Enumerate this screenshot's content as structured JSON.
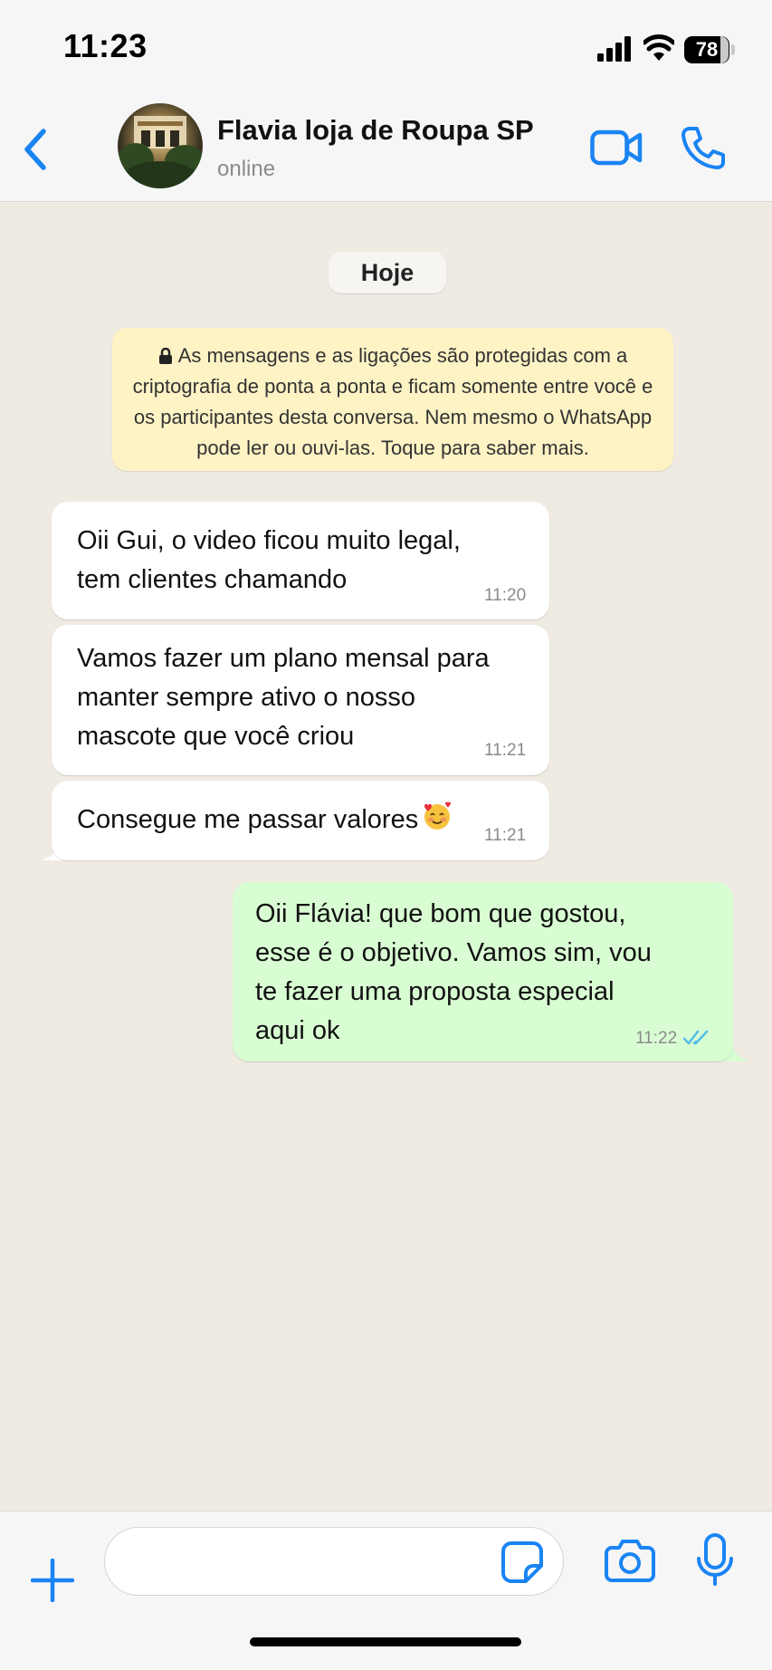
{
  "status_bar": {
    "time": "11:23",
    "battery_level": "78"
  },
  "header": {
    "contact_name": "Flavia loja de Roupa SP",
    "contact_status": "online"
  },
  "chat": {
    "date_label": "Hoje",
    "encryption_notice": "As mensagens e as ligações são protegidas com a criptografia de ponta a ponta e ficam somente entre você e os participantes desta conversa. Nem mesmo o WhatsApp pode ler ou ouvi-las. Toque para saber mais.",
    "messages": [
      {
        "direction": "incoming",
        "text": "Oii Gui, o video ficou muito legal,\ntem clientes chamando",
        "time": "11:20"
      },
      {
        "direction": "incoming",
        "text": "Vamos fazer um plano mensal para\nmanter sempre ativo o nosso\nmascote que você criou",
        "time": "11:21"
      },
      {
        "direction": "incoming",
        "text": "Consegue me passar valores",
        "emoji": "smiling-face-with-hearts",
        "time": "11:21"
      },
      {
        "direction": "outgoing",
        "text": "Oii Flávia! que bom que gostou,\nesse é o objetivo. Vamos sim, vou\nte fazer uma proposta especial\naqui ok",
        "time": "11:22",
        "read_status": "read"
      }
    ]
  },
  "composer": {
    "input_value": "",
    "input_placeholder": ""
  },
  "colors": {
    "accent": "#1a84f3",
    "chat_background": "#efeae2",
    "incoming_bubble": "#ffffff",
    "outgoing_bubble": "#d9fdd3",
    "notice_background": "#fdf3c5",
    "read_ticks": "#53bdeb"
  },
  "icons": {
    "back": "chevron-left-icon",
    "video_call": "video-camera-icon",
    "voice_call": "phone-icon",
    "attach": "plus-icon",
    "sticker": "sticker-icon",
    "camera": "camera-icon",
    "microphone": "microphone-icon",
    "lock": "lock-icon",
    "read_receipt": "double-check-icon"
  }
}
